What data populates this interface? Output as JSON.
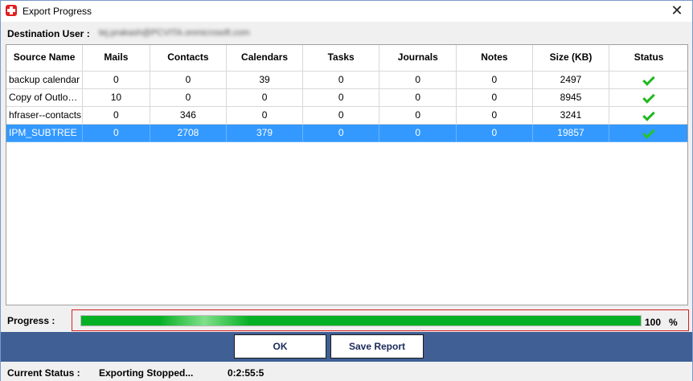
{
  "window": {
    "title": "Export Progress",
    "close_glyph": "✕"
  },
  "destination": {
    "label": "Destination User :",
    "value": "tej.prakash@PCVITA.onmicrosoft.com"
  },
  "table": {
    "columns": [
      "Source Name",
      "Mails",
      "Contacts",
      "Calendars",
      "Tasks",
      "Journals",
      "Notes",
      "Size (KB)",
      "Status"
    ],
    "rows": [
      {
        "source": "backup calendar",
        "mails": "0",
        "contacts": "0",
        "calendars": "39",
        "tasks": "0",
        "journals": "0",
        "notes": "0",
        "size": "2497",
        "status_icon": "check-icon"
      },
      {
        "source": "Copy of Outlook Contacts",
        "mails": "10",
        "contacts": "0",
        "calendars": "0",
        "tasks": "0",
        "journals": "0",
        "notes": "0",
        "size": "8945",
        "status_icon": "check-icon"
      },
      {
        "source": "hfraser--contacts",
        "mails": "0",
        "contacts": "346",
        "calendars": "0",
        "tasks": "0",
        "journals": "0",
        "notes": "0",
        "size": "3241",
        "status_icon": "check-icon"
      },
      {
        "source": "IPM_SUBTREE",
        "mails": "0",
        "contacts": "2708",
        "calendars": "379",
        "tasks": "0",
        "journals": "0",
        "notes": "0",
        "size": "19857",
        "status_icon": "check-icon",
        "selected": true
      }
    ]
  },
  "progress": {
    "label": "Progress :",
    "value": "100",
    "unit": "%",
    "fraction": 1.0,
    "color": "#06b025"
  },
  "buttons": {
    "ok": "OK",
    "save_report": "Save Report"
  },
  "status": {
    "label": "Current Status :",
    "text": "Exporting Stopped...",
    "elapsed": "0:2:55:5"
  },
  "colors": {
    "accent_bar": "#3f5f95",
    "selection": "#3399ff",
    "check": "#1fb81f",
    "progress_border": "#d42020"
  }
}
